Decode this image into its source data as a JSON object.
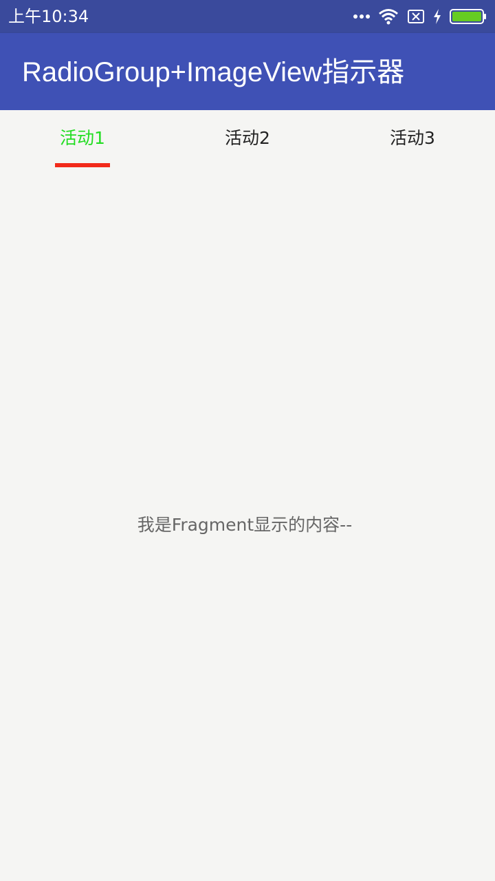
{
  "status_bar": {
    "time": "上午10:34",
    "icons": [
      "more-dots-icon",
      "wifi-icon",
      "no-sim-icon",
      "charging-bolt-icon",
      "battery-icon"
    ]
  },
  "app_bar": {
    "title": "RadioGroup+ImageView指示器",
    "color": "#3f51b5"
  },
  "tabs": [
    {
      "label": "活动1",
      "selected": true,
      "color": "#22dd22"
    },
    {
      "label": "活动2",
      "selected": false,
      "color": "#222222"
    },
    {
      "label": "活动3",
      "selected": false,
      "color": "#222222"
    }
  ],
  "indicator": {
    "color": "#f22a1a",
    "selected_index": 0
  },
  "fragment": {
    "content": "我是Fragment显示的内容--"
  }
}
